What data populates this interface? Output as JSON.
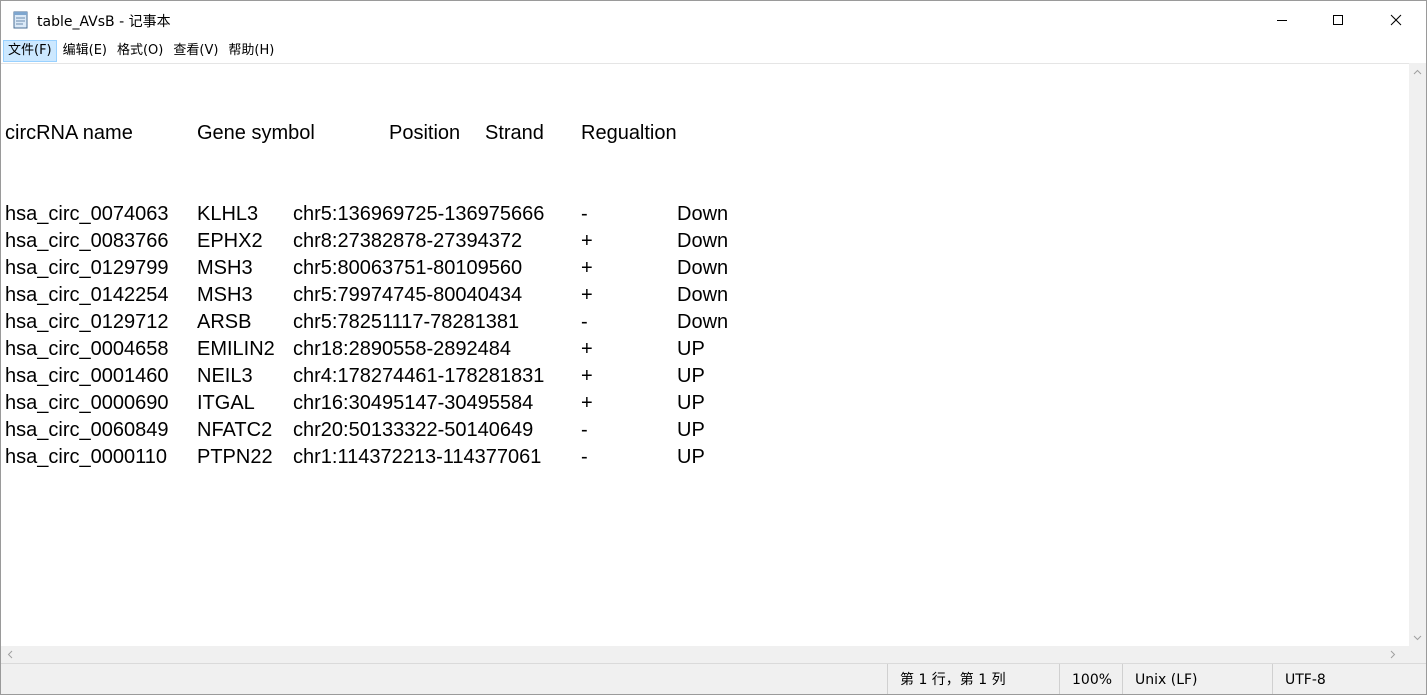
{
  "window": {
    "title": "table_AVsB - 记事本"
  },
  "menu": {
    "items": [
      "文件(F)",
      "编辑(E)",
      "格式(O)",
      "查看(V)",
      "帮助(H)"
    ]
  },
  "document": {
    "header": [
      "circRNA name",
      "Gene symbol",
      "Position",
      "Strand",
      "Regualtion"
    ],
    "rows": [
      [
        "hsa_circ_0074063",
        "KLHL3",
        "chr5:136969725-136975666",
        "-",
        "Down"
      ],
      [
        "hsa_circ_0083766",
        "EPHX2",
        "chr8:27382878-27394372",
        "+",
        "Down"
      ],
      [
        "hsa_circ_0129799",
        "MSH3",
        "chr5:80063751-80109560",
        "+",
        "Down"
      ],
      [
        "hsa_circ_0142254",
        "MSH3",
        "chr5:79974745-80040434",
        "+",
        "Down"
      ],
      [
        "hsa_circ_0129712",
        "ARSB",
        "chr5:78251117-78281381",
        "-",
        "Down"
      ],
      [
        "hsa_circ_0004658",
        "EMILIN2",
        "chr18:2890558-2892484",
        "+",
        "UP"
      ],
      [
        "hsa_circ_0001460",
        "NEIL3",
        "chr4:178274461-178281831",
        "+",
        "UP"
      ],
      [
        "hsa_circ_0000690",
        "ITGAL",
        "chr16:30495147-30495584",
        "+",
        "UP"
      ],
      [
        "hsa_circ_0060849",
        "NFATC2",
        "chr20:50133322-50140649",
        "-",
        "UP"
      ],
      [
        "hsa_circ_0000110",
        "PTPN22",
        "chr1:114372213-114377061",
        "-",
        "UP"
      ]
    ]
  },
  "status": {
    "position": "第 1 行，第 1 列",
    "zoom": "100%",
    "line_ending": "Unix (LF)",
    "encoding": "UTF-8"
  }
}
